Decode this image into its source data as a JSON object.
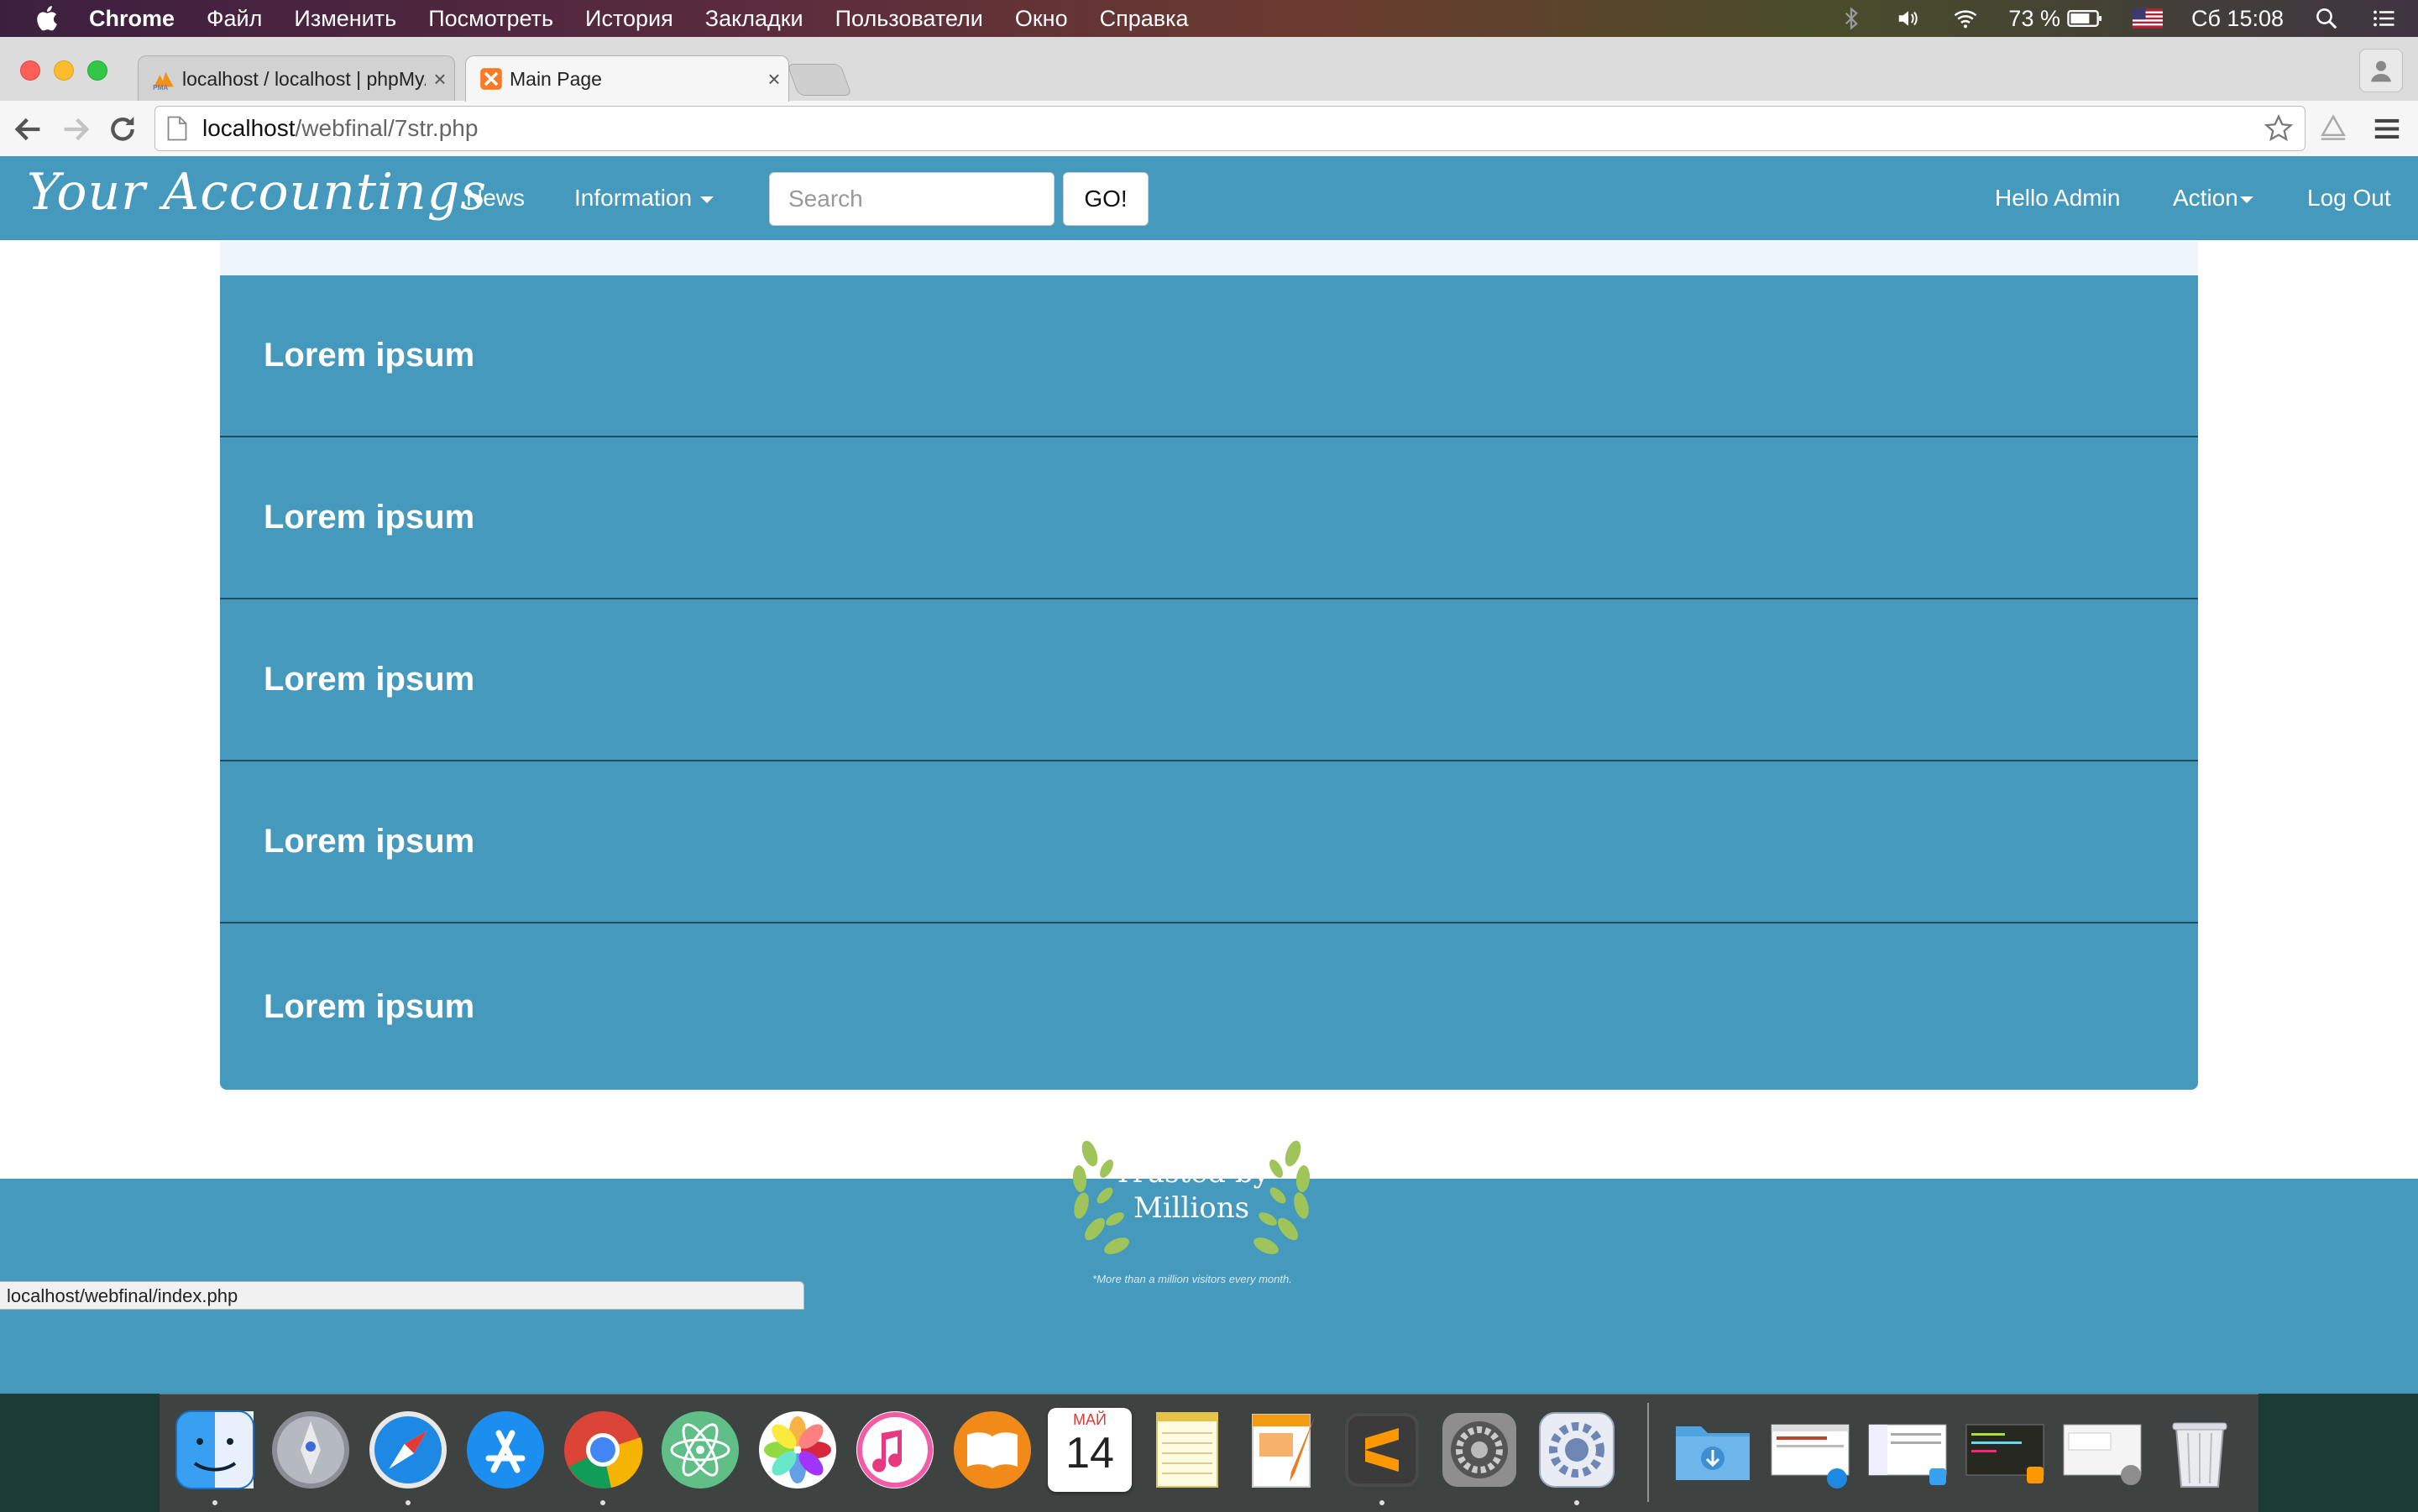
{
  "menubar": {
    "app_name": "Chrome",
    "items": [
      "Файл",
      "Изменить",
      "Посмотреть",
      "История",
      "Закладки",
      "Пользователи",
      "Окно",
      "Справка"
    ],
    "battery": "73 %",
    "clock": "Сб 15:08"
  },
  "browser": {
    "tabs": [
      {
        "title": "localhost / localhost | phpMyAdmin",
        "favicon": "phpmyadmin-icon",
        "active": false
      },
      {
        "title": "Main Page",
        "favicon": "xampp-icon",
        "active": true
      }
    ],
    "url_host": "localhost",
    "url_path": "/webfinal/7str.php",
    "status_url": "localhost/webfinal/index.php"
  },
  "site": {
    "brand": "Your Accountings",
    "nav": {
      "news": "News",
      "information": "Information",
      "search_placeholder": "Search",
      "go": "GO!",
      "hello": "Hello Admin",
      "action": "Action",
      "logout": "Log Out"
    },
    "panel_rows": [
      "Lorem ipsum",
      "Lorem ipsum",
      "Lorem ipsum",
      "Lorem ipsum",
      "Lorem ipsum"
    ],
    "footer": {
      "badge_line1": "Trusted by",
      "badge_line2": "Millions",
      "badge_note": "*More than a million visitors every month."
    }
  },
  "dock": {
    "calendar_month": "МАЙ",
    "calendar_day": "14",
    "apps": [
      "finder-icon",
      "launchpad-icon",
      "safari-icon",
      "app-store-icon",
      "chrome-icon",
      "atom-icon",
      "photos-icon",
      "itunes-icon",
      "ibooks-icon",
      "calendar-icon",
      "notes-icon",
      "pages-icon",
      "sublime-text-icon",
      "system-preferences-icon",
      "gear-app-icon"
    ],
    "stack": [
      "downloads-folder-icon",
      "safari-window-thumbnail",
      "finder-window-thumbnail",
      "sublime-window-thumbnail",
      "preferences-window-thumbnail",
      "trash-icon"
    ]
  },
  "colors": {
    "primary": "#4599bd",
    "divider": "#1f4d5f"
  }
}
